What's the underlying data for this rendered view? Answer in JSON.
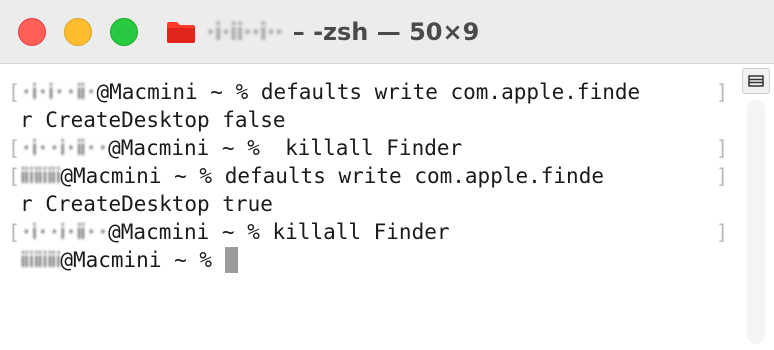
{
  "window": {
    "title_user": "·ⅰ·ⅱ··ⅰ··",
    "title": "– -zsh — 50×9",
    "folder_icon": "folder-icon"
  },
  "terminal": {
    "lines": [
      {
        "user": "·ⅰ·ⅰ··ⅱ·",
        "text": "@Macmini ~ % defaults write com.apple.finde",
        "open": "[",
        "close": "]"
      },
      {
        "user": "",
        "text": "r CreateDesktop false",
        "open": "",
        "close": ""
      },
      {
        "user": "·ⅰ··ⅰ·ⅱ··",
        "text": "@Macmini ~ %  killall Finder",
        "open": "[",
        "close": "]"
      },
      {
        "user": "ⅱⅰⅱⅰⅱⅰ",
        "text": "@Macmini ~ % defaults write com.apple.finde",
        "open": "[",
        "close": "]"
      },
      {
        "user": "",
        "text": "r CreateDesktop true",
        "open": "",
        "close": ""
      },
      {
        "user": "·ⅰ··ⅰ·ⅱ··",
        "text": "@Macmini ~ % killall Finder",
        "open": "[",
        "close": "]"
      },
      {
        "user": "ⅱⅰⅱⅰⅱⅰ",
        "text": "@Macmini ~ % ",
        "open": "",
        "close": ""
      }
    ]
  },
  "colors": {
    "close": "#ff5f57",
    "minimize": "#febc2e",
    "zoom": "#28c840",
    "folder": "#ff3b30"
  }
}
